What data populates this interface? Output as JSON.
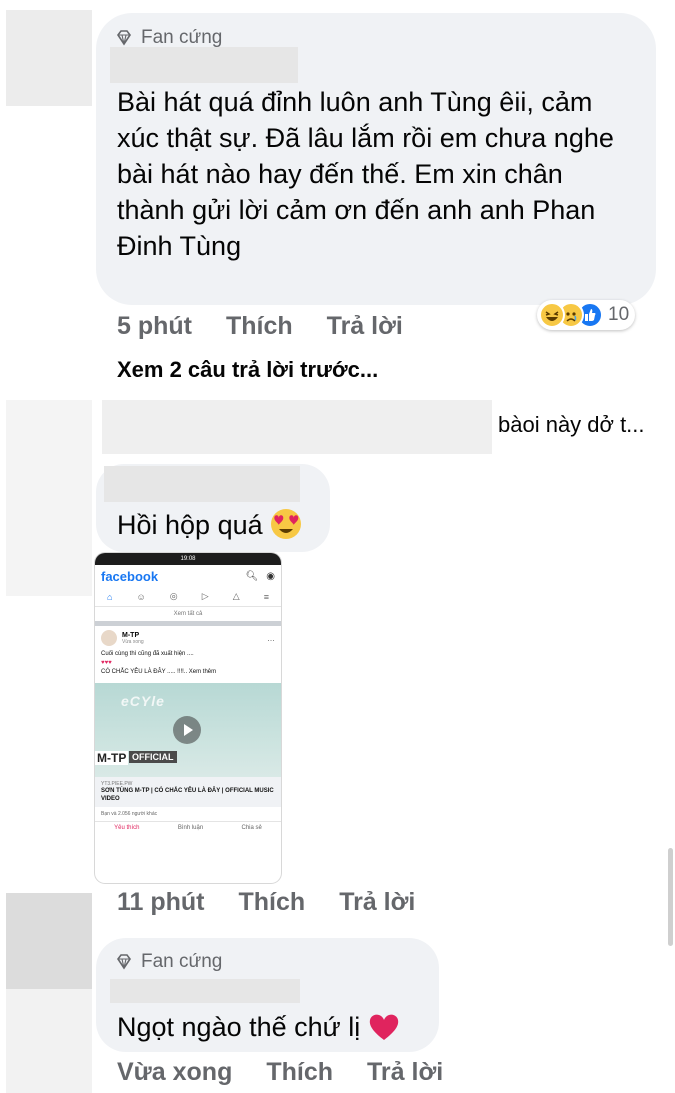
{
  "comments": [
    {
      "badge": "Fan cứng",
      "text": "Bài hát quá đỉnh luôn anh Tùng êii, cảm xúc thật sự. Đã lâu lắm rồi em chưa nghe bài hát nào hay đến thế. Em xin chân thành gửi lời cảm ơn đến anh anh Phan Đinh Tùng",
      "time": "5 phút",
      "like_label": "Thích",
      "reply_label": "Trả lời",
      "reaction_count": "10",
      "reactions": [
        "haha-icon",
        "sad-icon",
        "like-icon"
      ]
    },
    {
      "text": "bàoi này dở t..."
    },
    {
      "text": "Hồi hộp quá",
      "emoji": "heart-eyes-emoji",
      "time": "11 phút",
      "like_label": "Thích",
      "reply_label": "Trả lời"
    },
    {
      "badge": "Fan cứng",
      "text": "Ngọt ngào thế chứ lị",
      "emoji": "red-heart-emoji",
      "time": "Vừa xong",
      "like_label": "Thích",
      "reply_label": "Trả lời"
    }
  ],
  "view_previous": "Xem 2 câu trả lời trước...",
  "attachment": {
    "status_time": "19:08",
    "app_name": "facebook",
    "see_all": "Xem tất cả",
    "post_author": "M-TP",
    "post_time": "Vừa xong",
    "post_text_1": "Cuối cùng thì cũng đã xuất hiện ....",
    "post_text_2": "CÓ CHẮC YÊU LÀ ĐÂY ..... !!!!.. Xem thêm",
    "video_overlay_logo": "M-TP",
    "video_overlay_label": "OFFICIAL",
    "link_host": "YT3.PIEE.PW",
    "link_title": "SƠN TÙNG M-TP | CÓ CHẮC YÊU LÀ ĐÂY | OFFICIAL MUSIC VIDEO",
    "likes_text": "Bạn và 2.056 người khác",
    "action_like": "Yêu thích",
    "action_comment": "Bình luận",
    "action_share": "Chia sẻ"
  },
  "colors": {
    "bubble": "#f0f2f5",
    "meta": "#65676b",
    "facebook_blue": "#1877f2"
  }
}
